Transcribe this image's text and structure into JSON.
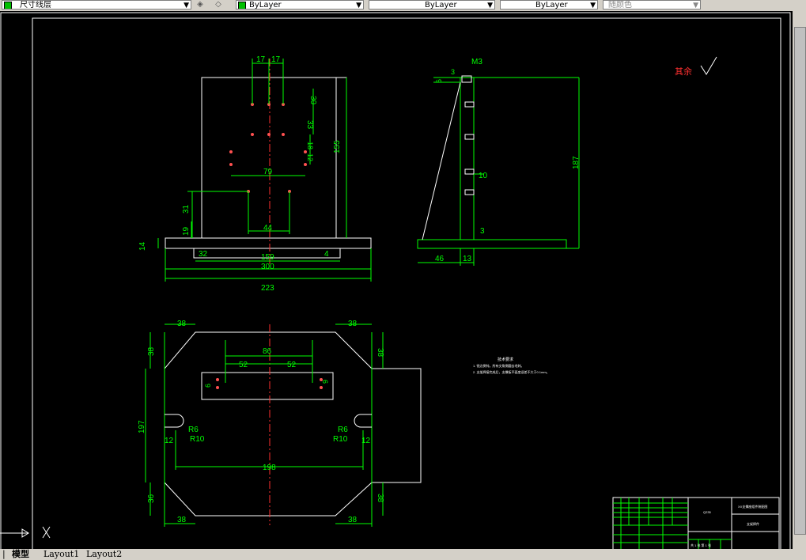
{
  "toolbar": {
    "layer_name": "尺寸线层",
    "color": "ByLayer",
    "linetype": "ByLayer",
    "lineweight": "ByLayer",
    "plotstyle": "随颜色"
  },
  "tabs": [
    {
      "label": "模型"
    },
    {
      "label": "Layout1"
    },
    {
      "label": "Layout2"
    }
  ],
  "drawing": {
    "front_view": {
      "dims": [
        "17",
        "17",
        "30",
        "33",
        "18",
        "12",
        "155",
        "79",
        "44",
        "31",
        "19",
        "14",
        "32",
        "159",
        "300",
        "223",
        "4"
      ]
    },
    "side_view": {
      "dims": [
        "6",
        "3",
        "M3",
        "187",
        "10",
        "3",
        "46",
        "13"
      ]
    },
    "top_view": {
      "dims": [
        "38",
        "38",
        "38",
        "38",
        "86",
        "52",
        "52",
        "6",
        "6",
        "197",
        "R6",
        "R10",
        "R6",
        "R10",
        "12",
        "12",
        "198",
        "36",
        "38",
        "38",
        "38"
      ]
    },
    "surface_note": "其余",
    "tech_req": {
      "title": "技术要求",
      "line1": "1. 锐边倒钝，所有尖角倒圆去毛刺。",
      "line2": "2. 支架焊接完成后，支撑板平面度误差不大于0.1mm。"
    },
    "title_block": {
      "drawing_title": "XX支撑座组件装配图",
      "part_name": "支架焊件",
      "material": "Q235",
      "sheet": "共 1 张 第 1 张"
    }
  },
  "colors": {
    "background": "#000000",
    "dimension": "#00ff00",
    "outline": "#ffffff",
    "centerline": "#ff0000",
    "highlight": "#ffff00"
  }
}
